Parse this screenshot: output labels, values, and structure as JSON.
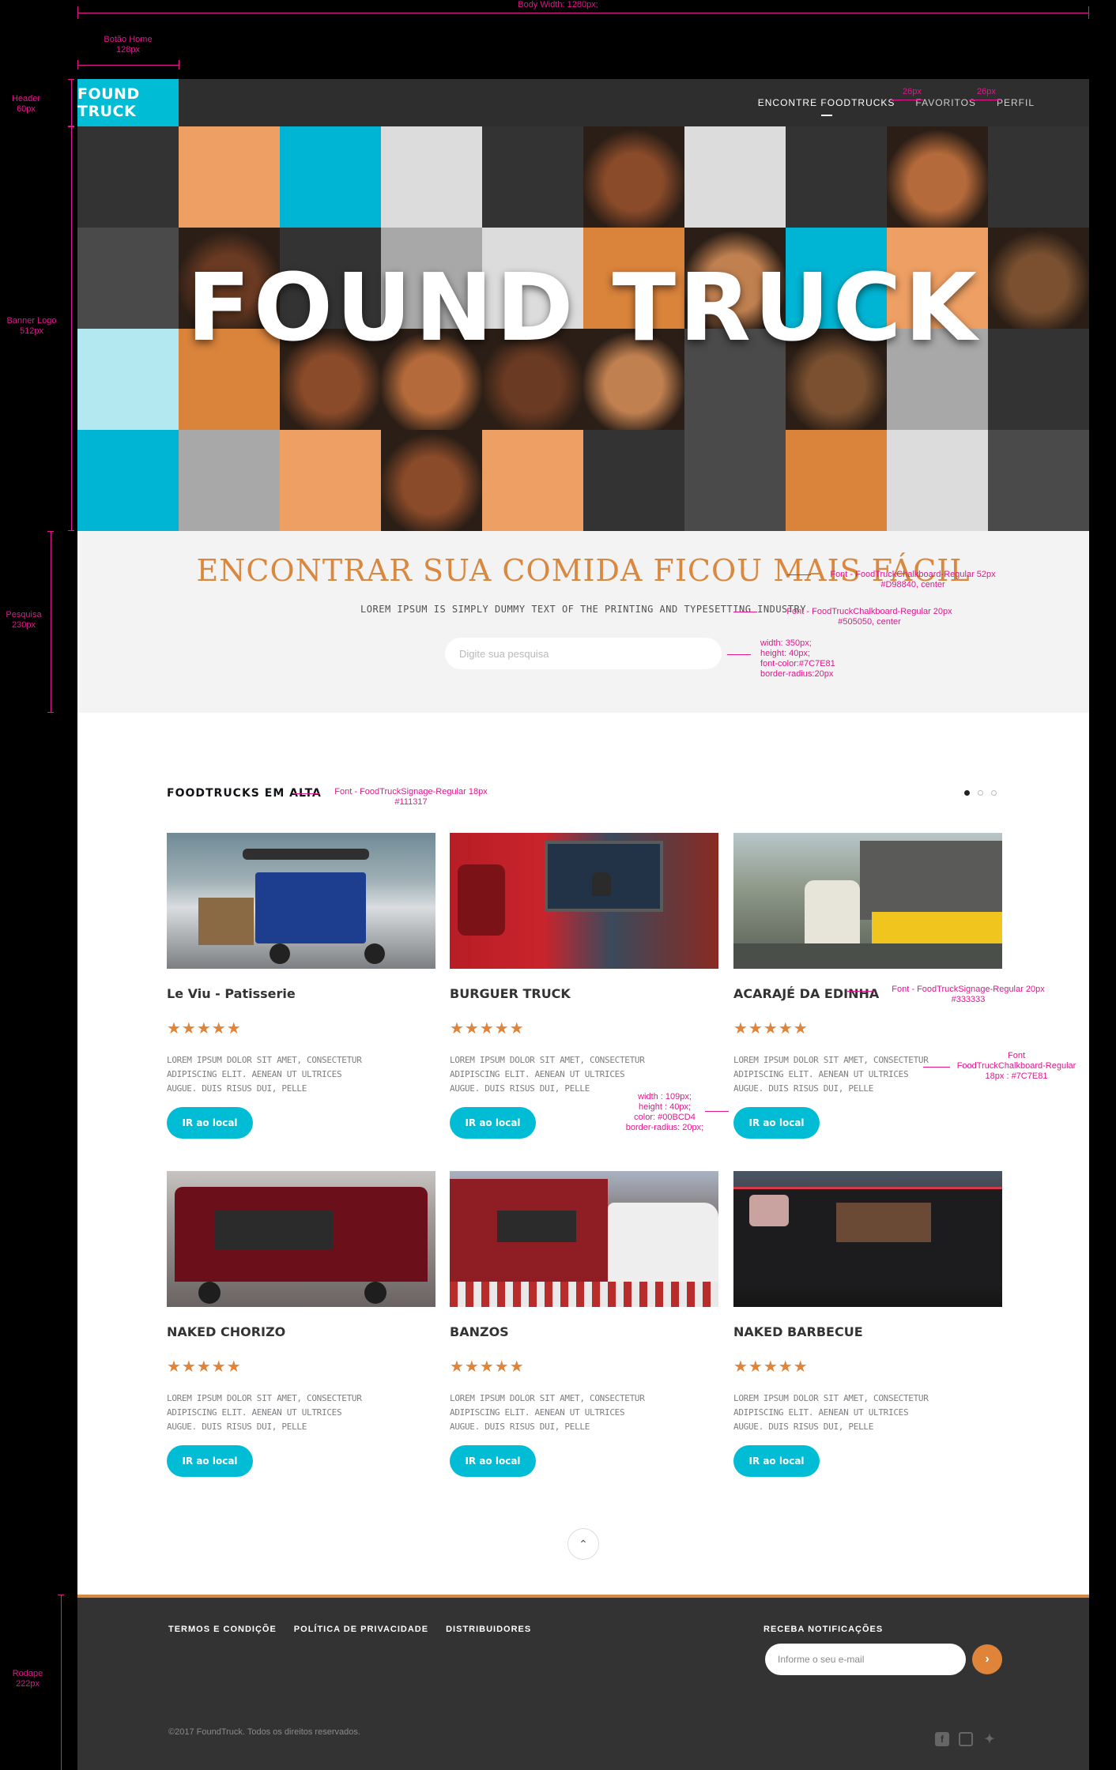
{
  "annotations": {
    "body_width": "Body Width: 1280px;",
    "botao_home": [
      "Botão Home",
      "128px"
    ],
    "header": [
      "Header",
      "60px"
    ],
    "banner": [
      "Banner Logo",
      "512px"
    ],
    "pesquisa": [
      "Pesquisa",
      "230px"
    ],
    "rodape": [
      "Rodape",
      "222px"
    ],
    "nav_gap_1": "26px",
    "nav_gap_2": "26px",
    "search_title_font": [
      "Font - FoodTruckChalkboard-Regular 52px",
      "#D98840, center"
    ],
    "search_sub_font": [
      "Font - FoodTruckChalkboard-Regular 20px",
      "#505050, center"
    ],
    "search_input_spec": [
      "width: 350px;",
      "height: 40px;",
      "font-color:#7C7E81",
      "border-radius:20px"
    ],
    "section_title_font": [
      "Font - FoodTruckSignage-Regular 18px",
      "#111317"
    ],
    "card_name_font": [
      "Font - FoodTruckSignage-Regular 20px",
      "#333333"
    ],
    "card_desc_font": [
      "Font",
      "FoodTruckChalkboard-Regular",
      "18px : #7C7E81"
    ],
    "button_spec": [
      "width : 109px;",
      "height : 40px;",
      "color: #00BCD4",
      "border-radius: 20px;"
    ]
  },
  "header": {
    "logo": "FOUND TRUCK",
    "nav": [
      "ENCONTRE FOODTRUCKS",
      "FAVORITOS",
      "PERFIL"
    ]
  },
  "banner": {
    "title": "FOUND TRUCK",
    "colors": [
      "#333333",
      "#ee9f63",
      "#00b5d4",
      "#dcdcdc",
      "#d9833b",
      "#a8a8a8",
      "#b3e8f0",
      "#4a4a4a"
    ]
  },
  "search": {
    "title": "ENCONTRAR SUA COMIDA FICOU MAIS FÁCIL",
    "subtitle": "LOREM IPSUM IS SIMPLY DUMMY TEXT OF THE PRINTING AND TYPESETTING INDUSTRY",
    "placeholder": "Digite sua pesquisa"
  },
  "trending": {
    "title": "FOODTRUCKS EM ALTA",
    "stars": "★★★★★",
    "button_label": "IR ao local",
    "cards": [
      {
        "name": "Le Viu - Patisserie",
        "desc": "LOREM IPSUM DOLOR SIT AMET, CONSECTETUR ADIPISCING ELIT. AENEAN UT ULTRICES AUGUE. DUIS RISUS DUI, PELLE",
        "rating": 5
      },
      {
        "name": "BURGUER TRUCK",
        "desc": "LOREM IPSUM DOLOR SIT AMET, CONSECTETUR ADIPISCING ELIT. AENEAN UT ULTRICES AUGUE. DUIS RISUS DUI, PELLE",
        "rating": 5
      },
      {
        "name": "ACARAJÉ DA EDINHA",
        "desc": "LOREM IPSUM DOLOR SIT AMET, CONSECTETUR ADIPISCING ELIT. AENEAN UT ULTRICES AUGUE. DUIS RISUS DUI, PELLE",
        "rating": 5
      },
      {
        "name": "NAKED CHORIZO",
        "desc": "LOREM IPSUM DOLOR SIT AMET, CONSECTETUR ADIPISCING ELIT. AENEAN UT ULTRICES AUGUE. DUIS RISUS DUI, PELLE",
        "rating": 5
      },
      {
        "name": "BANZOS",
        "desc": "LOREM IPSUM DOLOR SIT AMET, CONSECTETUR ADIPISCING ELIT. AENEAN UT ULTRICES AUGUE. DUIS RISUS DUI, PELLE",
        "rating": 5
      },
      {
        "name": "NAKED BARBECUE",
        "desc": "LOREM IPSUM DOLOR SIT AMET, CONSECTETUR ADIPISCING ELIT. AENEAN UT ULTRICES AUGUE. DUIS RISUS DUI, PELLE",
        "rating": 5
      }
    ]
  },
  "footer": {
    "links": [
      "TERMOS E CONDIÇÕE",
      "POLÍTICA DE PRIVACIDADE",
      "DISTRIBUIDORES"
    ],
    "notif_label": "RECEBA NOTIFICAÇÕES",
    "email_placeholder": "Informe o seu e-mail",
    "copyright": "©2017 FoundTruck.  Todos os direitos reservados.",
    "social": [
      "facebook-icon",
      "instagram-icon",
      "twitter-icon"
    ]
  }
}
